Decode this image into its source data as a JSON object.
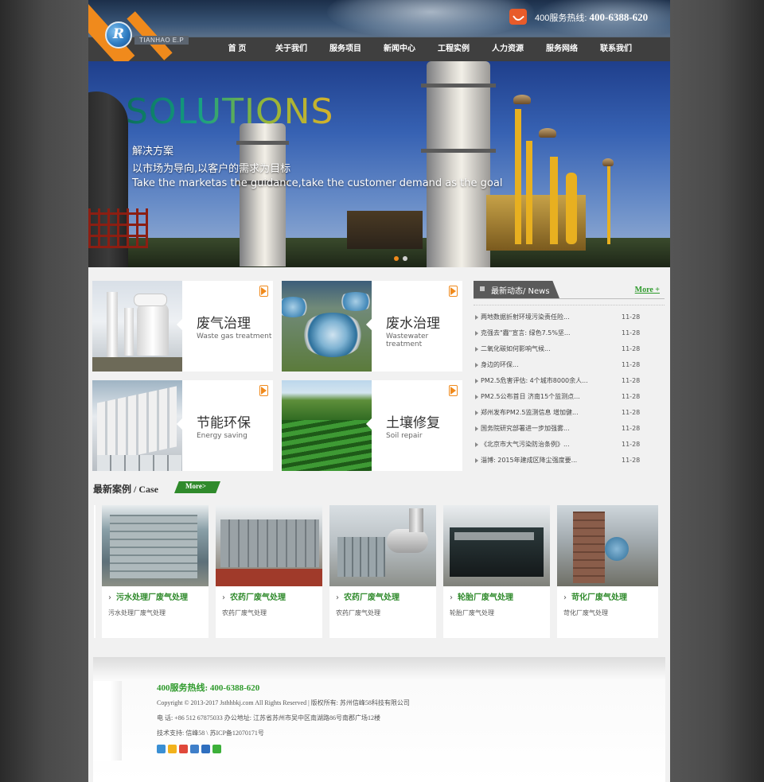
{
  "header": {
    "logo_letter": "R",
    "logo_text": "TIANHAO E.P",
    "hotline_label": "400服务热线:",
    "hotline_number": "400-6388-620"
  },
  "nav": [
    "首 页",
    "关于我们",
    "服务项目",
    "新闻中心",
    "工程实例",
    "人力资源",
    "服务网络",
    "联系我们"
  ],
  "banner": {
    "title": "SOLUTIONS",
    "line1": "解决方案",
    "line2": "以市场为导向,以客户的需求为目标",
    "line3": "Take the marketas the guidance,take the customer demand as the goal"
  },
  "services": [
    {
      "cn": "废气治理",
      "en": "Waste gas treatment"
    },
    {
      "cn": "废水治理",
      "en": "Wastewater treatment"
    },
    {
      "cn": "节能环保",
      "en": "Energy saving"
    },
    {
      "cn": "土壤修复",
      "en": "Soil repair"
    }
  ],
  "news": {
    "tab": "最新动态/ News",
    "more": "More +",
    "items": [
      {
        "title": "两地数据折射环境污染责任险...",
        "date": "11-28"
      },
      {
        "title": "克强去\"霾\"宣言: 绿色7.5%坚...",
        "date": "11-28"
      },
      {
        "title": "二氧化碳如何影响气候...",
        "date": "11-28"
      },
      {
        "title": "身边的环保...",
        "date": "11-28"
      },
      {
        "title": "PM2.5危害评估: 4个城市8000余人...",
        "date": "11-28"
      },
      {
        "title": "PM2.5公布首日 济南15个监测点...",
        "date": "11-28"
      },
      {
        "title": "郑州发布PM2.5监测信息 增加健...",
        "date": "11-28"
      },
      {
        "title": "国务院研究部署进一步加强雾...",
        "date": "11-28"
      },
      {
        "title": "《北京市大气污染防治条例》...",
        "date": "11-28"
      },
      {
        "title": "淄博: 2015年建成区降尘强度要...",
        "date": "11-28"
      }
    ]
  },
  "cases": {
    "title": "最新案例 / Case",
    "more": "More>",
    "items": [
      {
        "title": "污水处理厂废气处理",
        "desc": "污水处理厂废气处理"
      },
      {
        "title": "农药厂废气处理",
        "desc": "农药厂废气处理"
      },
      {
        "title": "农药厂废气处理",
        "desc": "农药厂废气处理"
      },
      {
        "title": "轮胎厂废气处理",
        "desc": "轮胎厂废气处理"
      },
      {
        "title": "苛化厂废气处理",
        "desc": "苛化厂废气处理"
      }
    ]
  },
  "footer": {
    "hotline": "400服务热线: 400-6388-620",
    "copyright": "Copyright © 2013-2017 Jsthhbkj.com All Rights Reserved | 版权所有: 苏州信峰58科技有限公司",
    "contact": "电 话: +86 512 67875033 办公地址: 江苏省苏州市吴中区南湖路86号南郡广场12楼",
    "support": "技术支持: 信峰58 \\ 苏ICP备12070171号"
  },
  "colors": {
    "accent_orange": "#f08a1c",
    "accent_green": "#2f8a2b",
    "nav_bg": "#3f3f3f"
  }
}
